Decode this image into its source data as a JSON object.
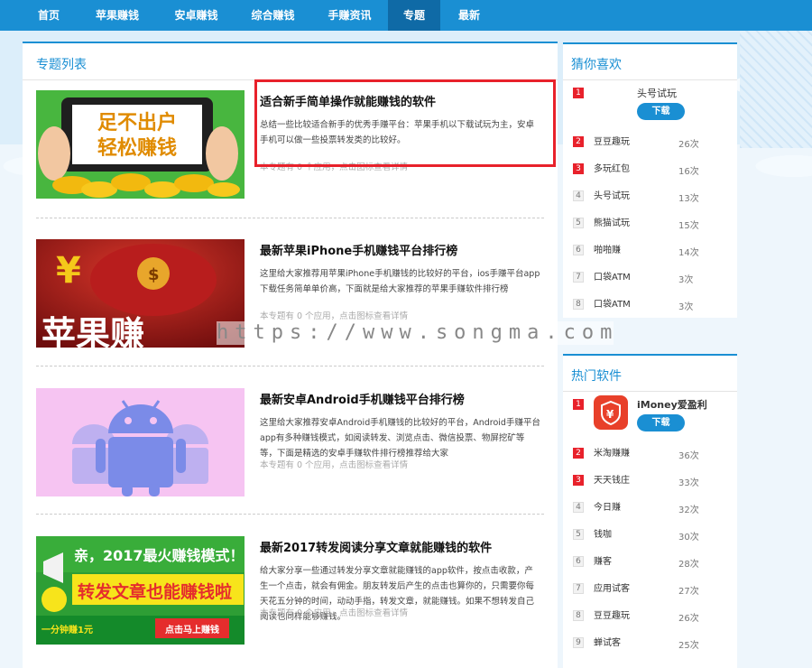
{
  "nav": {
    "items": [
      {
        "label": "首页"
      },
      {
        "label": "苹果赚钱"
      },
      {
        "label": "安卓赚钱"
      },
      {
        "label": "综合赚钱"
      },
      {
        "label": "手赚资讯"
      },
      {
        "label": "专题",
        "active": true
      },
      {
        "label": "最新"
      }
    ]
  },
  "main": {
    "title": "专题列表",
    "items": [
      {
        "title": "适合新手简单操作就能赚钱的软件",
        "desc": "总结一些比较适合新手的优秀手赚平台：苹果手机以下载试玩为主，安卓手机可以做一些投票转发类的比较好。",
        "meta": "本专题有 0 个应用，点击图标查看详情",
        "thumb_lines": [
          "足不出户",
          "轻松赚钱"
        ]
      },
      {
        "title": "最新苹果iPhone手机赚钱平台排行榜",
        "desc": "这里给大家推荐用苹果iPhone手机赚钱的比较好的平台，ios手赚平台app下载任务简单单价高，下面就是给大家推荐的苹果手赚软件排行榜",
        "meta": "本专题有 0 个应用，点击图标查看详情",
        "thumb_lines": [
          "苹果赚"
        ]
      },
      {
        "title": "最新安卓Android手机赚钱平台排行榜",
        "desc": "这里给大家推荐安卓Android手机赚钱的比较好的平台，Android手赚平台app有多种赚钱模式，如阅读转发、浏览点击、微信投票、物屏挖矿等等，下面是精选的安卓手赚软件排行榜推荐给大家",
        "meta": "本专题有 0 个应用，点击图标查看详情",
        "thumb_lines": []
      },
      {
        "title": "最新2017转发阅读分享文章就能赚钱的软件",
        "desc": "给大家分享一些通过转发分享文章就能赚钱的app软件，按点击收款，产生一个点击，就会有佣金。朋友转发后产生的点击也算你的，只需要你每天花五分钟的时间，动动手指，转发文章，就能赚钱。如果不想转发自己阅读也同样能够赚钱。",
        "meta": "本专题有 0 个应用，点击图标查看详情",
        "thumb_lines": [
          "亲，2017最火赚钱模式！",
          "转发文章也能赚钱啦",
          "一分钟赚1元",
          "点击马上赚钱"
        ]
      }
    ]
  },
  "guess": {
    "title": "猜你喜欢",
    "top": {
      "rank": "1",
      "name": "头号试玩",
      "button": "下载"
    },
    "items": [
      {
        "rank": "2",
        "name": "豆豆趣玩",
        "count": "26次"
      },
      {
        "rank": "3",
        "name": "多玩红包",
        "count": "16次"
      },
      {
        "rank": "4",
        "name": "头号试玩",
        "count": "13次"
      },
      {
        "rank": "5",
        "name": "熊猫试玩",
        "count": "15次"
      },
      {
        "rank": "6",
        "name": "啪啪赚",
        "count": "14次"
      },
      {
        "rank": "7",
        "name": "口袋ATM",
        "count": "3次"
      },
      {
        "rank": "8",
        "name": "口袋ATM",
        "count": "3次"
      }
    ]
  },
  "hot": {
    "title": "热门软件",
    "top": {
      "rank": "1",
      "name": "iMoney爱盈利",
      "button": "下载"
    },
    "items": [
      {
        "rank": "2",
        "name": "米淘赚赚",
        "count": "36次"
      },
      {
        "rank": "3",
        "name": "天天钱庄",
        "count": "33次"
      },
      {
        "rank": "4",
        "name": "今日赚",
        "count": "32次"
      },
      {
        "rank": "5",
        "name": "钱咖",
        "count": "30次"
      },
      {
        "rank": "6",
        "name": "赚客",
        "count": "28次"
      },
      {
        "rank": "7",
        "name": "应用试客",
        "count": "27次"
      },
      {
        "rank": "8",
        "name": "豆豆趣玩",
        "count": "26次"
      },
      {
        "rank": "9",
        "name": "蝉试客",
        "count": "25次"
      }
    ]
  },
  "watermark": "https://www.songma.com"
}
